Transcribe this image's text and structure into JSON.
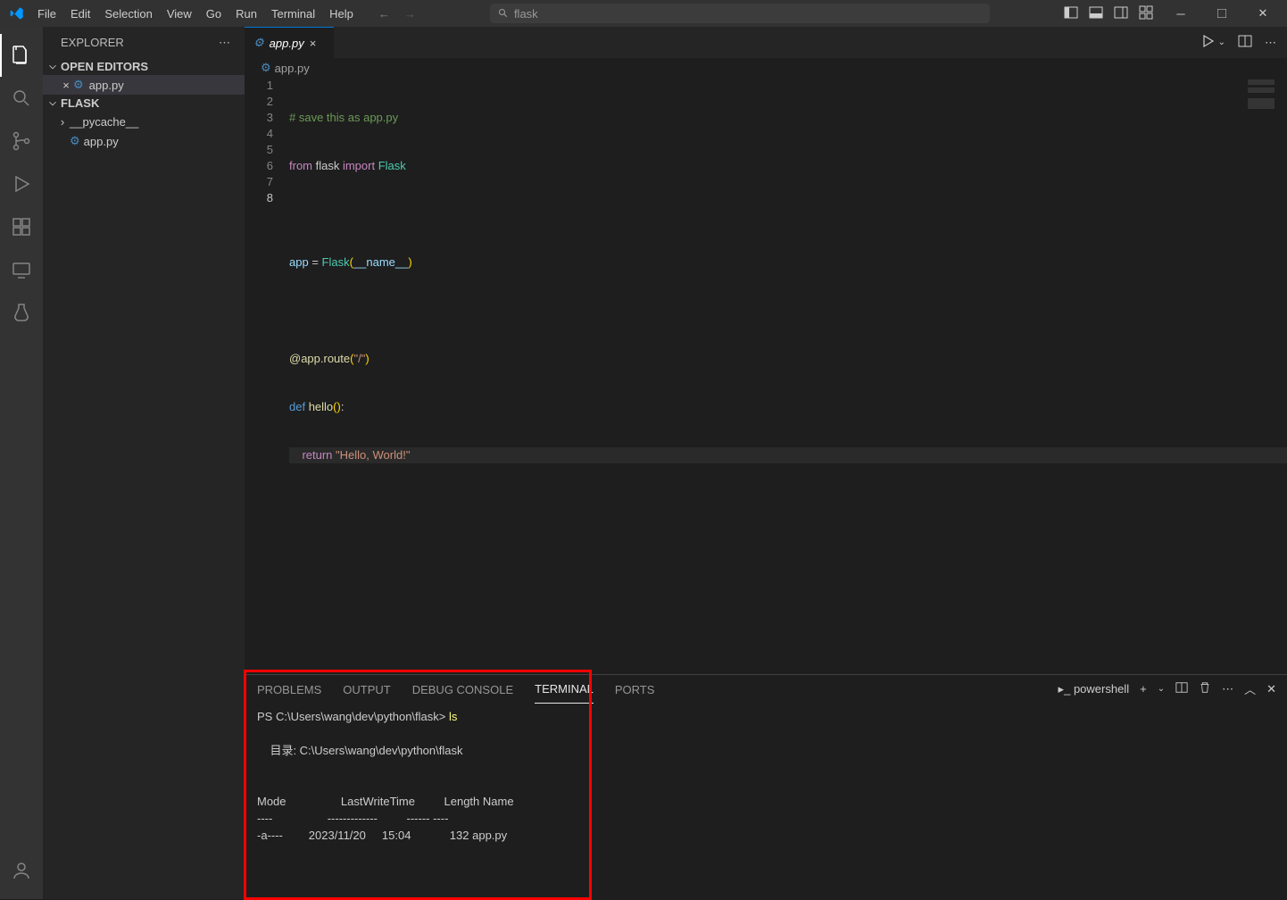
{
  "menu": [
    "File",
    "Edit",
    "Selection",
    "View",
    "Go",
    "Run",
    "Terminal",
    "Help"
  ],
  "search_text": "flask",
  "sidebar": {
    "title": "EXPLORER",
    "sections": {
      "open_editors": "OPEN EDITORS",
      "project": "FLASK"
    },
    "open_editor": "app.py",
    "tree": {
      "folder": "__pycache__",
      "file": "app.py"
    }
  },
  "tab": {
    "name": "app.py"
  },
  "breadcrumb": "app.py",
  "code": {
    "l1_comment": "# save this as app.py",
    "l2_from": "from",
    "l2_flask": " flask ",
    "l2_import": "import",
    "l2_Flask": " Flask",
    "l4_app": "app ",
    "l4_eq": "= ",
    "l4_Flask": "Flask",
    "l4_po": "(",
    "l4_name": "__name__",
    "l4_pc": ")",
    "l6_at": "@app.route",
    "l6_po": "(",
    "l6_str": "\"/\"",
    "l6_pc": ")",
    "l7_def": "def",
    "l7_hello": " hello",
    "l7_po": "(",
    "l7_pc": ")",
    "l7_colon": ":",
    "l8_pad": "    ",
    "l8_return": "return",
    "l8_str": " \"Hello, World!\""
  },
  "line_numbers": [
    "1",
    "2",
    "3",
    "4",
    "5",
    "6",
    "7",
    "8"
  ],
  "panel": {
    "tabs": [
      "PROBLEMS",
      "OUTPUT",
      "DEBUG CONSOLE",
      "TERMINAL",
      "PORTS"
    ],
    "active": "TERMINAL",
    "shell": "powershell",
    "content_prompt": "PS C:\\Users\\wang\\dev\\python\\flask> ",
    "content_cmd": "ls",
    "content_body": "\n\n    目录: C:\\Users\\wang\\dev\\python\\flask\n\n\nMode                 LastWriteTime         Length Name\n----                 -------------         ------ ----\n-a----        2023/11/20     15:04            132 app.py"
  }
}
